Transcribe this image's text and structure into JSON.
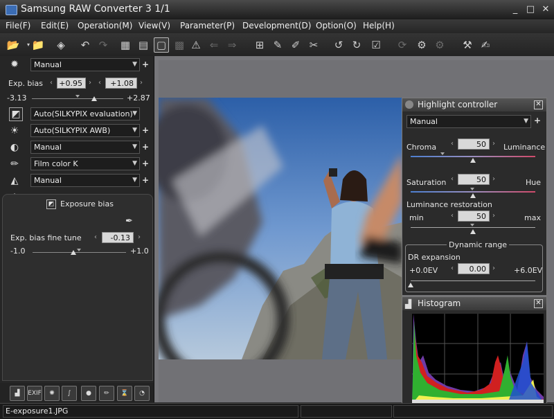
{
  "window": {
    "title": "Samsung RAW Converter 3   1/1",
    "minimize": "_",
    "maximize": "□",
    "close": "✕"
  },
  "menu": [
    "File(F)",
    "Edit(E)",
    "Operation(M)",
    "View(V)",
    "Parameter(P)",
    "Development(D)",
    "Option(O)",
    "Help(H)"
  ],
  "toolbar_icons": [
    "open-folder-icon",
    "open-folder-icon",
    "eraser-icon",
    "undo-icon",
    "redo-icon",
    "grid-view-icon",
    "filmstrip-view-icon",
    "single-view-icon",
    "compare-view-icon",
    "warning-icon",
    "previous-icon",
    "next-icon",
    "crosshair-icon",
    "dropper-icon",
    "dropper-white-icon",
    "scissors-icon",
    "rotate-left-icon",
    "rotate-right-icon",
    "checkbox-icon",
    "refresh-icon",
    "batch-develop-icon",
    "develop-icon",
    "hammer-icon",
    "notepad-icon"
  ],
  "left_panel": {
    "taste": {
      "value": "Manual"
    },
    "exposure": {
      "label": "Exp. bias",
      "value_left": "+0.95",
      "value_right": "+1.08",
      "min": "-3.13",
      "max": "+2.87",
      "level": 0.68
    },
    "tone": {
      "value": "Auto(SILKYPIX evaluation)"
    },
    "white_balance": {
      "value": "Auto(SILKYPIX AWB)"
    },
    "contrast": {
      "value": "Manual"
    },
    "color": {
      "value": "Film color K"
    },
    "sharpness": {
      "value": "Manual"
    },
    "sub_panel": {
      "title": "Exposure bias",
      "fine_tune_label": "Exp. bias fine tune",
      "fine_tune_value": "-0.13",
      "min": "-1.0",
      "max": "+1.0",
      "level": 0.435
    }
  },
  "highlight_controller": {
    "title": "Highlight controller",
    "preset": "Manual",
    "chroma_label": "Chroma",
    "luminance_label": "Luminance",
    "chroma_value": "50",
    "saturation_label": "Saturation",
    "hue_label": "Hue",
    "saturation_value": "50",
    "lum_restore_label": "Luminance restoration",
    "min_label": "min",
    "max_label": "max",
    "lum_restore_value": "50",
    "dynamic_range_label": "Dynamic range",
    "dr_expansion_label": "DR expansion",
    "dr_min": "+0.0EV",
    "dr_max": "+6.0EV",
    "dr_value": "0.00",
    "dr_level": 0.0
  },
  "histogram": {
    "title": "Histogram"
  },
  "status": {
    "filename": "E-exposure1.JPG"
  },
  "colors": {
    "accent": "#3b6db5",
    "panel": "#262626"
  }
}
